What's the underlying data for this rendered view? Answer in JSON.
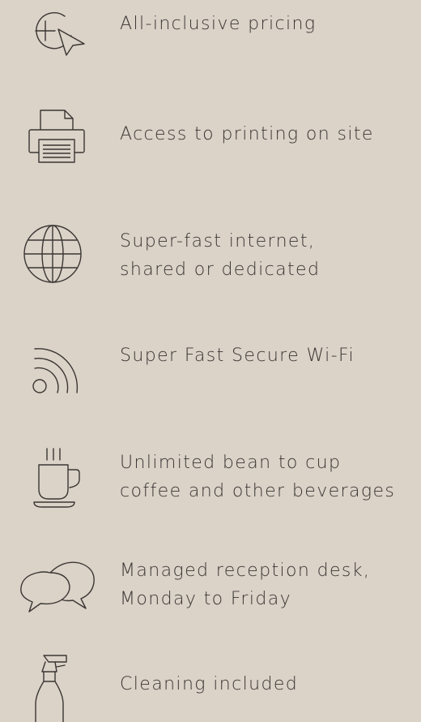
{
  "features": [
    {
      "icon": "add-cursor-icon",
      "lines": [
        "All-inclusive pricing"
      ]
    },
    {
      "icon": "printer-icon",
      "lines": [
        "Access to printing on site"
      ]
    },
    {
      "icon": "globe-icon",
      "lines": [
        "Super-fast internet,",
        "shared or dedicated"
      ]
    },
    {
      "icon": "wifi-icon",
      "lines": [
        "Super Fast Secure Wi-Fi"
      ]
    },
    {
      "icon": "coffee-cup-icon",
      "lines": [
        "Unlimited bean to cup",
        "coffee and other beverages"
      ]
    },
    {
      "icon": "chat-bubbles-icon",
      "lines": [
        "Managed reception desk,",
        "Monday to Friday"
      ]
    },
    {
      "icon": "spray-bottle-icon",
      "lines": [
        "Cleaning included"
      ]
    }
  ],
  "colors": {
    "background": "#dbd2c8",
    "text": "#3a3633",
    "icon_stroke": "#3a3633"
  }
}
